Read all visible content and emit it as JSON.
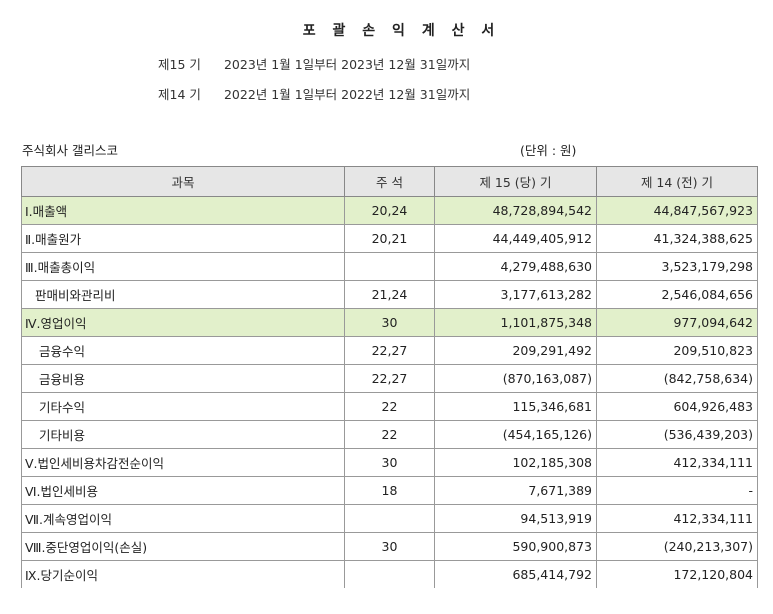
{
  "title": "포 괄 손 익 계 산 서",
  "periods": [
    {
      "label": "제15 기",
      "range": "2023년 1월 1일부터 2023년 12월 31일까지"
    },
    {
      "label": "제14 기",
      "range": "2022년 1월 1일부터 2022년 12월 31일까지"
    }
  ],
  "company": "주식회사 갤리스코",
  "unit": "(단위 : 원)",
  "headers": [
    "과목",
    "주 석",
    "제 15 (당) 기",
    "제 14 (전) 기"
  ],
  "rows": [
    {
      "item": "Ⅰ.매출액",
      "note": "20,24",
      "cur": "48,728,894,542",
      "prev": "44,847,567,923"
    },
    {
      "item": "Ⅱ.매출원가",
      "note": "20,21",
      "cur": "44,449,405,912",
      "prev": "41,324,388,625"
    },
    {
      "item": "Ⅲ.매출총이익",
      "note": "",
      "cur": "4,279,488,630",
      "prev": "3,523,179,298"
    },
    {
      "item": "판매비와관리비",
      "note": "21,24",
      "cur": "3,177,613,282",
      "prev": "2,546,084,656"
    },
    {
      "item": "Ⅳ.영업이익",
      "note": "30",
      "cur": "1,101,875,348",
      "prev": "977,094,642"
    },
    {
      "item": "금융수익",
      "note": "22,27",
      "cur": "209,291,492",
      "prev": "209,510,823"
    },
    {
      "item": "금융비용",
      "note": "22,27",
      "cur": "(870,163,087)",
      "prev": "(842,758,634)"
    },
    {
      "item": "기타수익",
      "note": "22",
      "cur": "115,346,681",
      "prev": "604,926,483"
    },
    {
      "item": "기타비용",
      "note": "22",
      "cur": "(454,165,126)",
      "prev": "(536,439,203)"
    },
    {
      "item": "Ⅴ.법인세비용차감전순이익",
      "note": "30",
      "cur": "102,185,308",
      "prev": "412,334,111"
    },
    {
      "item": "Ⅵ.법인세비용",
      "note": "18",
      "cur": "7,671,389",
      "prev": "-"
    },
    {
      "item": "Ⅶ.계속영업이익",
      "note": "",
      "cur": "94,513,919",
      "prev": "412,334,111"
    },
    {
      "item": "Ⅷ.중단영업이익(손실)",
      "note": "30",
      "cur": "590,900,873",
      "prev": "(240,213,307)"
    },
    {
      "item": "Ⅸ.당기순이익",
      "note": "",
      "cur": "685,414,792",
      "prev": "172,120,804"
    }
  ],
  "highlight_color": "#e2f0cb"
}
